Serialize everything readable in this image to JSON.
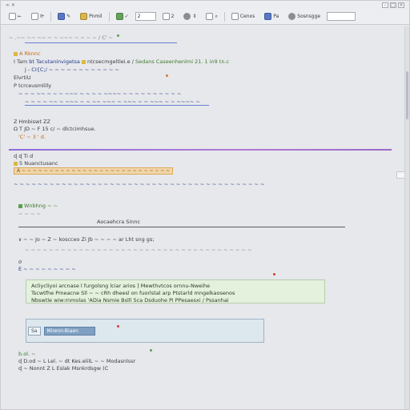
{
  "window": {
    "title": "∞ ✕",
    "controls": [
      "–",
      "□",
      "✕"
    ]
  },
  "toolbar": {
    "items": [
      {
        "name": "undo-button",
        "label": "←"
      },
      {
        "name": "redo-button",
        "label": "⟳"
      },
      {
        "name": "edit-button",
        "label": "✎ "
      },
      {
        "name": "view-button",
        "label": "Pnmil"
      },
      {
        "name": "refresh-button",
        "label": "✓"
      },
      {
        "name": "check-button",
        "label": "2 "
      },
      {
        "name": "tools-button",
        "label": "⇕"
      },
      {
        "name": "options-button",
        "label": "⌕"
      },
      {
        "name": "group-button",
        "label": "Cenxs"
      },
      {
        "name": "alert-button",
        "label": "Pa"
      },
      {
        "name": "settings-button",
        "label": "Sosnsgge"
      }
    ],
    "field_value": "2"
  },
  "lines": {
    "l1": "~ .~~ ~~ ~~  ~ ~ ~~~ ~ ~ ~   ~  / C' ~",
    "l2": "A  Rknnc",
    "l3a": "I  Tam",
    "l3b": "bt  Tacutaninvigetsa",
    "l3c": "ntcsecmgeltlei.e /",
    "l3d": "Sedans Caseenhenlmi  21.  1  in9 tn.c",
    "l4": "j - CI{C;/ ~  ~ ~ ~ ~ ~  ~ ~ ~ ~ ~ ~",
    "l5": "ElvrtiU",
    "l6": "P  tcrceusmlilly",
    "l7": "~ ~ ~ ~~ ~  ~ ~  ~~~ ~ ~ ~ ~ ~~~~ ~ ~ ~  ~ ~ ~ ~ ~ ~ ~",
    "l8": "~ ~ ~  ~  ~~ ~ ~~~ ~ ~ ~~ ~~~ ~ ~~~  ~ ~  ~~~ ~ ~ ~~~~ ~",
    "l9": "Z  Hmbiswt  ZZ",
    "l10": "Ω  T  JD ~ F  15 c/ ~ dlctcimhsue.",
    "l11": "'C' ~ 3  '  d.",
    "l12": "ɖ  ɖ  Ti d",
    "l13": "5  Nuanctusanc",
    "l14": "A ~ ~ ~ ~ ~  ~ ~ ~  ~ ~ ~ ~ ~  ~ ~ ~ ~ ~ ~ ~ ~ ~ ~ ~ ~ ~ ~",
    "l15": "~ ~ ~ ~ ~ ~ ~ ~ ~ ~ ~ ~ ~ ~ ~ ~ ~ ~ ~ ~ ~ ~ ~ ~ ~ ~ ~ ~ ~ ~ ~ ~ ~ ~ ~ ~ ~ ~ ~ ~ ~ ~",
    "l16": "Wnbhng  ~ ~",
    "l17": "~ ~ ~ ~",
    "l18": "Aocaehcra Sinnc",
    "l19": "ɤ  ~ ~  Jo  ~  Z  ~  koscceo  Zi Jb  ~ ~ ~ ~  ar  Lht sng  gs;",
    "l20": "~ ~ ~ ~ ~ ~ ~ ~ ~ ~ ~ ~ ~ ~ ~ ~ ~ ~ ~ ~ ~ ~ ~ ~ ~  ~ ~ ~ ~ ~  ~ ~ ~ ~ ~ ~ ~ ~",
    "l21": "σ",
    "l22": "E  ~  ~ ~ ~ ~  ~ ~ ~  ~",
    "l23": "b.ol.  ~",
    "l24": "ɖ  D.od  ~ L  Lel. ~ dt  Kes.elilL  ~ ~  Modasnlssr",
    "l25": "ɖ  ~  Nonnt  Z L  Eslak  Msnkrdsgw (C"
  },
  "info_box": {
    "line1": "Acliycliyoi arcnase l furgolsng lciar  arios ]  Mewthvtcos ornnu-Nweihe",
    "line2": "Tscwtfhe Pmeacne  Sll ~ ~ cRh dheesl on fuorlstal arp Ptstarld mngelkaosenos",
    "line3": "Nbswtle wiw:rnmolas 'ADia  Nsmie  Bslll Sca  Dsduohe Pi  PPesaesxi  /  Pssanhai"
  },
  "panel": {
    "tab_left": "Sa",
    "tab_active": "Mirenn-Biaen"
  },
  "colors": {
    "background": "#e7e8eb",
    "accent_blue": "#5b6fc2",
    "accent_purple": "#a070d8",
    "info_green": "#e3f1dd",
    "panel_blue": "#dde7ee"
  }
}
